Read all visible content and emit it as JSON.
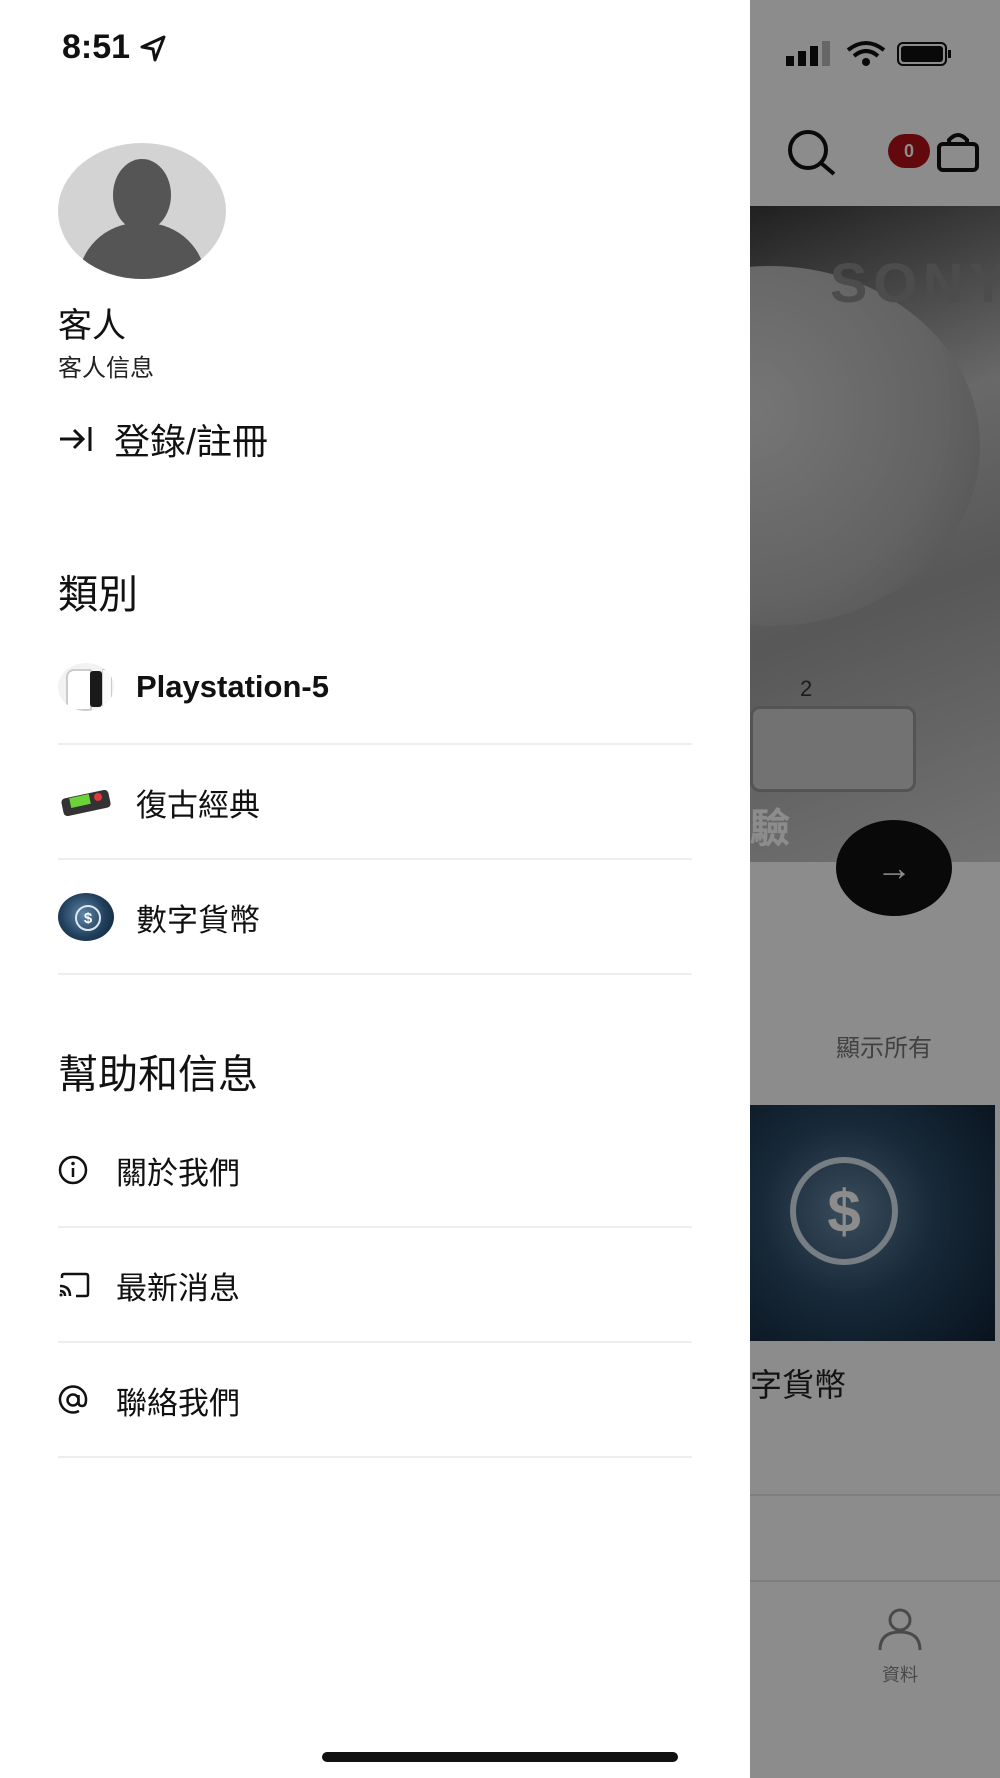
{
  "status_bar": {
    "time": "8:51"
  },
  "user": {
    "name": "客人",
    "subtitle": "客人信息",
    "login_label": "登錄/註冊"
  },
  "categories": {
    "title": "類別",
    "items": [
      {
        "label": "Playstation-5",
        "icon": "ps5-console-thumbnail"
      },
      {
        "label": "復古經典",
        "icon": "retro-console-thumbnail"
      },
      {
        "label": "數字貨幣",
        "icon": "digital-currency-thumbnail"
      }
    ]
  },
  "help": {
    "title": "幫助和信息",
    "items": [
      {
        "label": "關於我們",
        "icon": "info-icon"
      },
      {
        "label": "最新消息",
        "icon": "cast-icon"
      },
      {
        "label": "聯絡我們",
        "icon": "at-sign-icon"
      }
    ]
  },
  "background_app": {
    "cart_count": "0",
    "show_all": "顯示所有",
    "category_label": "字貨幣",
    "profile_tab": "資料",
    "hero_partial_text": "驗"
  },
  "colors": {
    "badge": "#b3121b",
    "scrim": "rgba(0,0,0,0.45)"
  }
}
